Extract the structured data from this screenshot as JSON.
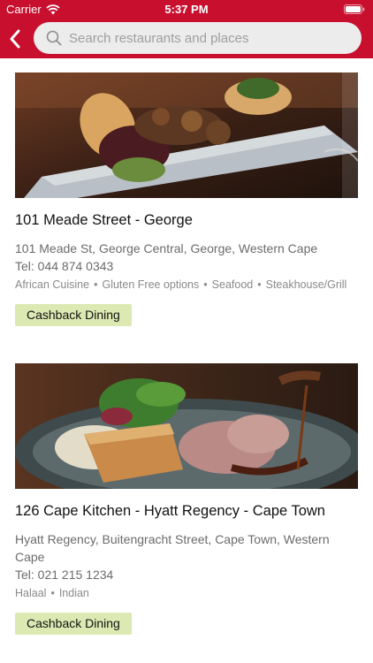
{
  "status_bar": {
    "carrier": "Carrier",
    "time": "5:37 PM"
  },
  "search": {
    "placeholder": "Search restaurants and places",
    "value": ""
  },
  "restaurants": [
    {
      "name": "101 Meade Street - George",
      "address": "101 Meade St, George Central, George, Western Cape",
      "tel": "Tel: 044 874 0343",
      "tags": [
        "African Cuisine",
        "Gluten Free options",
        "Seafood",
        "Steakhouse/Grill"
      ],
      "badge": "Cashback Dining"
    },
    {
      "name": "126 Cape Kitchen - Hyatt Regency - Cape Town",
      "address": "Hyatt Regency, Buitengracht Street, Cape Town, Western Cape",
      "tel": "Tel: 021 215 1234",
      "tags": [
        "Halaal",
        "Indian"
      ],
      "badge": "Cashback Dining"
    }
  ],
  "colors": {
    "brand": "#c8102e",
    "badge_bg": "#dde9b2"
  }
}
